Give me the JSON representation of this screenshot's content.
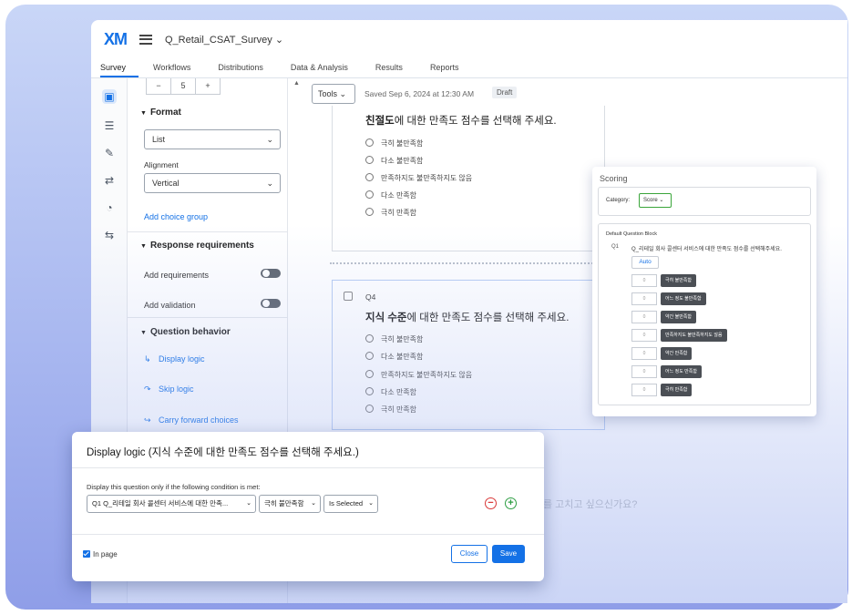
{
  "app": {
    "logo": "XM",
    "survey_name": "Q_Retail_CSAT_Survey",
    "tabs": [
      "Survey",
      "Workflows",
      "Distributions",
      "Data & Analysis",
      "Results",
      "Reports"
    ]
  },
  "panel": {
    "stepper": {
      "minus": "−",
      "value": "5",
      "plus": "+"
    },
    "format": {
      "title": "Format",
      "type_value": "List",
      "alignment_label": "Alignment",
      "alignment_value": "Vertical",
      "add_choice_group": "Add choice group"
    },
    "response": {
      "title": "Response requirements",
      "add_requirements": "Add requirements",
      "add_validation": "Add validation"
    },
    "behavior": {
      "title": "Question behavior",
      "display_logic": "Display logic",
      "skip_logic": "Skip logic",
      "carry_forward": "Carry forward choices"
    }
  },
  "toolbar": {
    "tools": "Tools",
    "saved": "Saved Sep 6, 2024 at 12:30 AM",
    "status": "Draft"
  },
  "q3": {
    "title_bold": "친절도",
    "title_rest": "에 대한 만족도 점수를 선택해 주세요.",
    "options": [
      "극히 불만족함",
      "다소 불만족함",
      "만족하지도 불만족하지도 않음",
      "다소 만족함",
      "극히 만족함"
    ]
  },
  "q4": {
    "number": "Q4",
    "title_bold": "지식 수준",
    "title_rest": "에 대한 만족도 점수를 선택해 주세요.",
    "options": [
      "극히 불만족함",
      "다소 불만족함",
      "만족하지도 불만족하지도 않음",
      "다소 만족함",
      "극히 만족함"
    ]
  },
  "scoring": {
    "title": "Scoring",
    "category_label": "Category:",
    "category_value": "Score",
    "block": "Default Question Block",
    "q_number": "Q1",
    "q_text": "Q_리테일 회사 콜센터 서비스에 대한 만족도 점수를 선택해주세요.",
    "auto": "Auto",
    "rows": [
      {
        "value": "0",
        "label": "극히 불만족함"
      },
      {
        "value": "0",
        "label": "어느 정도 불만족함"
      },
      {
        "value": "0",
        "label": "약간 불만족함"
      },
      {
        "value": "0",
        "label": "만족하지도 불만족하지도 않음"
      },
      {
        "value": "0",
        "label": "약간 만족함"
      },
      {
        "value": "0",
        "label": "어느 정도 만족함"
      },
      {
        "value": "0",
        "label": "극히 만족함"
      }
    ]
  },
  "modal": {
    "title": "Display logic (지식 수준에 대한 만족도 점수를 선택해 주세요.)",
    "condition_text": "Display this question only if the following condition is met:",
    "question_select": "Q1 Q_리테일 회사 콜센터 서비스에 대한 만족...",
    "choice_select": "극히 불만족함",
    "operator_select": "Is Selected",
    "in_page": "In page",
    "close": "Close",
    "save": "Save"
  },
  "background_text": "를 고치고 싶으신가요?"
}
